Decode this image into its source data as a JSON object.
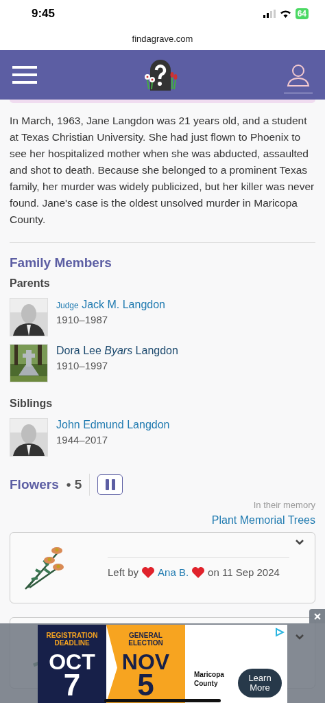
{
  "status_bar": {
    "time": "9:45",
    "battery": "64"
  },
  "browser": {
    "url": "findagrave.com"
  },
  "bio": "In March, 1963, Jane Langdon was 21 years old, and a student at Texas Christian University. She had just flown to Phoenix to see her hospitalized mother when she was abducted, assaulted and shot to death. Because she belonged to a prominent Texas family, her murder was widely publicized, but her killer was never found. Jane's case is the oldest unsolved murder in Maricopa County.",
  "family": {
    "title": "Family Members",
    "groups": [
      {
        "label": "Parents",
        "members": [
          {
            "prefix": "Judge",
            "name": "Jack M. Langdon",
            "dates": "1910–1987",
            "visited": false
          },
          {
            "name": "Dora Lee *Byars* Langdon",
            "dates": "1910–1997",
            "visited": true
          }
        ]
      },
      {
        "label": "Siblings",
        "members": [
          {
            "name": "John Edmund Langdon",
            "dates": "1944–2017",
            "visited": false
          }
        ]
      }
    ]
  },
  "flowers": {
    "title": "Flowers",
    "separator": "•",
    "count": "5",
    "memory_note": "In their memory",
    "plant_link": "Plant Memorial Trees",
    "cards": [
      {
        "left_by": "Left by",
        "author": "Ana B.",
        "date": "on 11 Sep 2024"
      },
      {
        "kind": "picture"
      }
    ]
  },
  "ad": {
    "left_top": "REGISTRATION DEADLINE",
    "left_month": "OCT",
    "left_day": "7",
    "mid_top": "GENERAL ELECTION",
    "mid_month": "NOV",
    "mid_day": "5",
    "advertiser": "Maricopa County",
    "cta": "Learn More"
  }
}
